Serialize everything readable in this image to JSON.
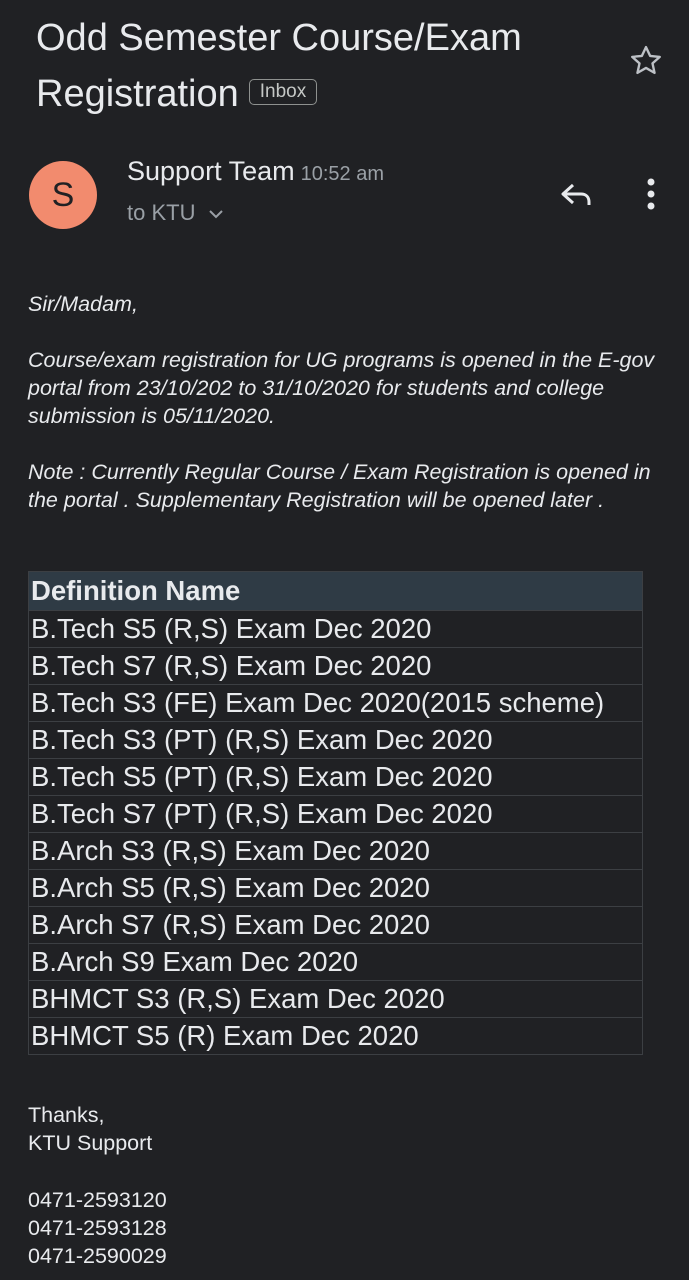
{
  "header": {
    "subject": "Odd Semester Course/Exam Registration",
    "label_chip": "Inbox"
  },
  "icons": {
    "star": "star-outline-icon",
    "reply": "reply-icon",
    "more": "more-vertical-icon",
    "expand": "chevron-down-icon"
  },
  "sender": {
    "initial": "S",
    "name": "Support Team",
    "time": "10:52 am",
    "recipient": "to KTU",
    "avatar_color": "#f28b6e"
  },
  "message": {
    "greeting": "Sir/Madam,",
    "paragraph1": "Course/exam registration for UG programs is opened in the E-gov portal from 23/10/202 to 31/10/2020 for students and college submission is 05/11/2020.",
    "paragraph2": "Note :  Currently Regular Course / Exam Registration is opened in the portal . Supplementary Registration will be opened later ."
  },
  "table": {
    "header": "Definition Name",
    "rows": [
      "B.Tech S5 (R,S) Exam Dec 2020",
      "B.Tech S7 (R,S) Exam Dec 2020",
      "B.Tech S3 (FE) Exam Dec 2020(2015 scheme)",
      "B.Tech S3 (PT) (R,S) Exam Dec 2020",
      "B.Tech S5 (PT) (R,S) Exam Dec 2020",
      "B.Tech S7 (PT) (R,S) Exam Dec 2020",
      "B.Arch S3 (R,S) Exam Dec 2020",
      "B.Arch S5 (R,S) Exam Dec 2020",
      "B.Arch S7 (R,S) Exam Dec 2020",
      "B.Arch S9 Exam Dec 2020",
      "BHMCT S3 (R,S) Exam Dec 2020",
      "BHMCT S5 (R) Exam Dec 2020"
    ]
  },
  "signature": {
    "thanks": "Thanks,",
    "team": "KTU Support",
    "phones": [
      "0471-2593120",
      "0471-2593128",
      "0471-2590029"
    ]
  }
}
